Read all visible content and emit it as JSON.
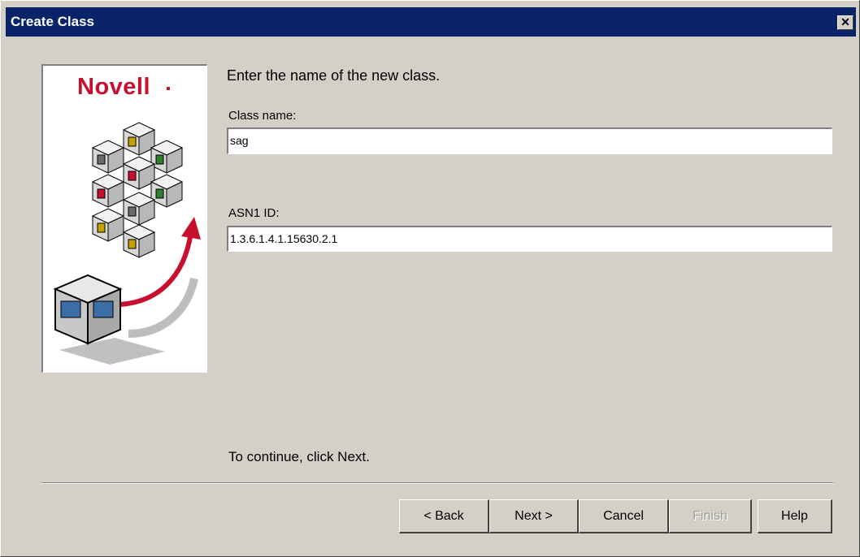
{
  "window": {
    "title": "Create Class",
    "close_symbol": "✕"
  },
  "graphic": {
    "logo_text": "Novell",
    "brand_color": "#c8102e"
  },
  "main": {
    "prompt": "Enter the name of the new class.",
    "class_name_label": "Class name:",
    "class_name_value": "sag",
    "asn1_label": "ASN1 ID:",
    "asn1_value": "1.3.6.1.4.1.15630.2.1",
    "continue_text": "To continue, click Next."
  },
  "buttons": {
    "back": "< Back",
    "next": "Next >",
    "cancel": "Cancel",
    "finish": "Finish",
    "help": "Help"
  },
  "colors": {
    "titlebar": "#0a246a",
    "dialog_bg": "#d4d0c8"
  }
}
